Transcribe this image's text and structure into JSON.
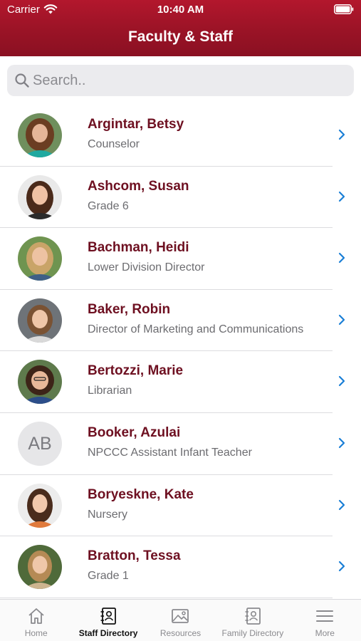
{
  "status_bar": {
    "carrier": "Carrier",
    "time": "10:40 AM"
  },
  "header": {
    "title": "Faculty & Staff"
  },
  "search": {
    "placeholder": "Search.."
  },
  "staff": [
    {
      "name": "Argintar, Betsy",
      "role": "Counselor"
    },
    {
      "name": "Ashcom, Susan",
      "role": "Grade 6"
    },
    {
      "name": "Bachman, Heidi",
      "role": "Lower Division Director"
    },
    {
      "name": "Baker, Robin",
      "role": "Director of Marketing and Communications"
    },
    {
      "name": "Bertozzi, Marie",
      "role": "Librarian"
    },
    {
      "name": "Booker, Azulai",
      "role": "NPCCC Assistant Infant Teacher",
      "initials": "AB"
    },
    {
      "name": "Boryeskne, Kate",
      "role": "Nursery"
    },
    {
      "name": "Bratton, Tessa",
      "role": "Grade 1"
    }
  ],
  "tabs": [
    {
      "label": "Home",
      "icon": "home-icon"
    },
    {
      "label": "Staff Directory",
      "icon": "staff-directory-icon",
      "active": true
    },
    {
      "label": "Resources",
      "icon": "image-icon"
    },
    {
      "label": "Family Directory",
      "icon": "family-directory-icon"
    },
    {
      "label": "More",
      "icon": "menu-icon"
    }
  ],
  "colors": {
    "header": "#9a1326",
    "name_text": "#6e1021",
    "chevron": "#1a7fd6"
  }
}
